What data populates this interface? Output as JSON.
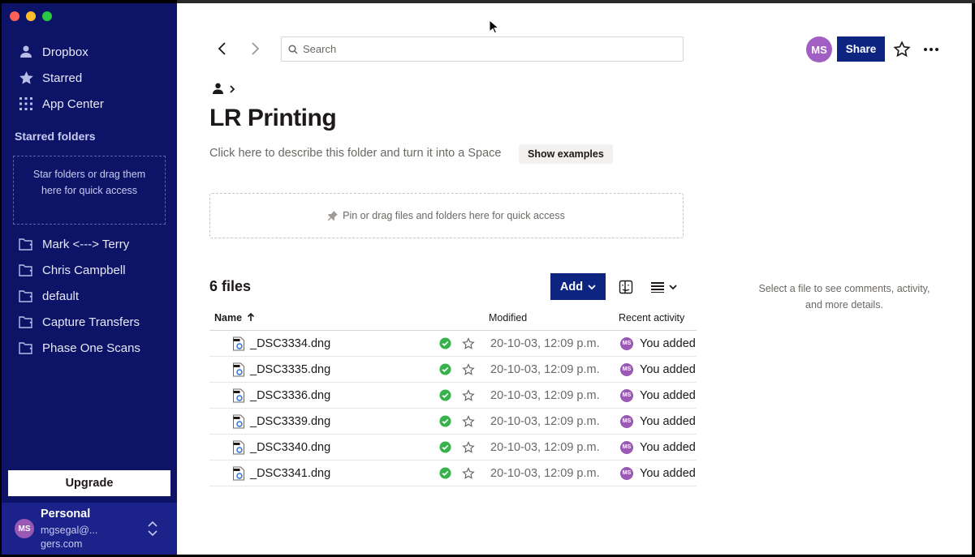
{
  "window": {
    "traffic_lights": [
      "#fe5f57",
      "#febc2e",
      "#28c840"
    ]
  },
  "sidebar": {
    "nav": [
      {
        "label": "Dropbox",
        "icon": "person-icon"
      },
      {
        "label": "Starred",
        "icon": "star-icon"
      },
      {
        "label": "App Center",
        "icon": "grid-icon"
      }
    ],
    "starred_title": "Starred folders",
    "starred_hint": "Star folders or drag them here for quick access",
    "folders": [
      {
        "label": "Mark <---> Terry",
        "icon": "shared-folder-icon"
      },
      {
        "label": "Chris Campbell",
        "icon": "shared-folder-icon"
      },
      {
        "label": "default",
        "icon": "shared-folder-icon"
      },
      {
        "label": "Capture Transfers",
        "icon": "shared-folder-icon"
      },
      {
        "label": "Phase One Scans",
        "icon": "shared-folder-icon"
      }
    ],
    "upgrade_label": "Upgrade",
    "account": {
      "initials": "MS",
      "name": "Personal",
      "email": "mgsegal@... gers.com"
    },
    "bg_color": "#0d1467"
  },
  "header": {
    "search_placeholder": "Search",
    "avatar_initials": "MS",
    "share_label": "Share"
  },
  "folder": {
    "title": "LR Printing",
    "description": "Click here to describe this folder and turn it into a Space",
    "examples_label": "Show examples",
    "pin_hint": "Pin or drag files and folders here for quick access",
    "count": "6 files",
    "add_label": "Add"
  },
  "table": {
    "columns": {
      "name": "Name",
      "modified": "Modified",
      "activity": "Recent activity"
    },
    "rows": [
      {
        "name": "_DSC3334.dng",
        "modified": "20-10-03, 12:09 p.m.",
        "activity": "You added",
        "initials": "MS"
      },
      {
        "name": "_DSC3335.dng",
        "modified": "20-10-03, 12:09 p.m.",
        "activity": "You added",
        "initials": "MS"
      },
      {
        "name": "_DSC3336.dng",
        "modified": "20-10-03, 12:09 p.m.",
        "activity": "You added",
        "initials": "MS"
      },
      {
        "name": "_DSC3339.dng",
        "modified": "20-10-03, 12:09 p.m.",
        "activity": "You added",
        "initials": "MS"
      },
      {
        "name": "_DSC3340.dng",
        "modified": "20-10-03, 12:09 p.m.",
        "activity": "You added",
        "initials": "MS"
      },
      {
        "name": "_DSC3341.dng",
        "modified": "20-10-03, 12:09 p.m.",
        "activity": "You added",
        "initials": "MS"
      }
    ]
  },
  "details_hint": "Select a file to see comments, activity, and more details.",
  "colors": {
    "primary": "#0d2481",
    "synced": "#37b24d",
    "avatar": "#a15fc4"
  }
}
